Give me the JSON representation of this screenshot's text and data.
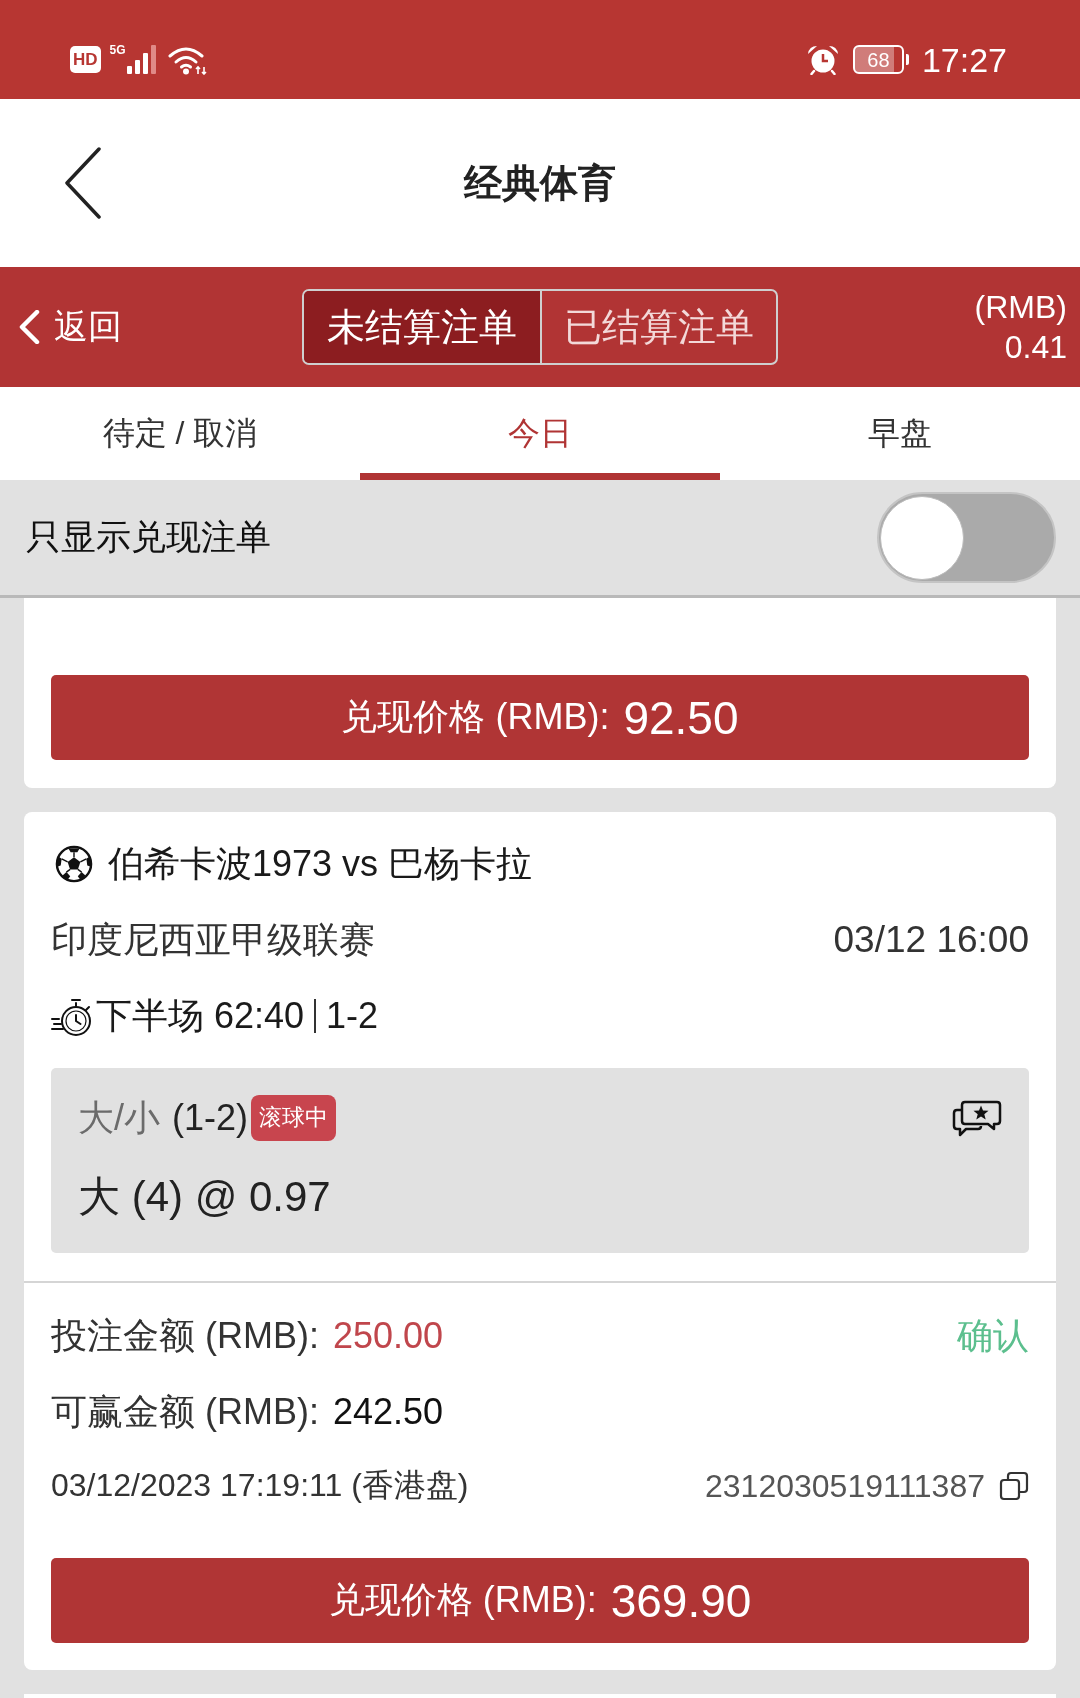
{
  "status_bar": {
    "hd": "HD",
    "network": "5G",
    "battery": "68",
    "time": "17:27"
  },
  "header": {
    "title": "经典体育"
  },
  "bet_header": {
    "back": "返回",
    "segments": [
      {
        "label": "未结算注单",
        "selected": true
      },
      {
        "label": "已结算注单",
        "selected": false
      }
    ],
    "currency": "(RMB)",
    "balance": "0.41"
  },
  "tabs": [
    {
      "label": "待定 / 取消",
      "selected": false
    },
    {
      "label": "今日",
      "selected": true
    },
    {
      "label": "早盘",
      "selected": false
    }
  ],
  "filter": {
    "label": "只显示兑现注单",
    "on": false
  },
  "bets": [
    {
      "cash_out_label": "兑现价格 (RMB):",
      "cash_out_amount": "92.50"
    },
    {
      "match": "伯希卡波1973 vs 巴杨卡拉",
      "league": "印度尼西亚甲级联赛",
      "kickoff": "03/12 16:00",
      "period": "下半场 62:40",
      "score": "1-2",
      "market": "大/小",
      "market_line": "(1-2)",
      "badge": "滚球中",
      "selection": "大 (4) @ 0.97",
      "stake_label": "投注金额 (RMB):",
      "stake": "250.00",
      "status": "确认",
      "payout_label": "可赢金额 (RMB):",
      "payout": "242.50",
      "placed_at": "03/12/2023 17:19:11 (香港盘)",
      "ticket_id": "2312030519111387",
      "cash_out_label": "兑现价格 (RMB):",
      "cash_out_amount": "369.90"
    }
  ]
}
